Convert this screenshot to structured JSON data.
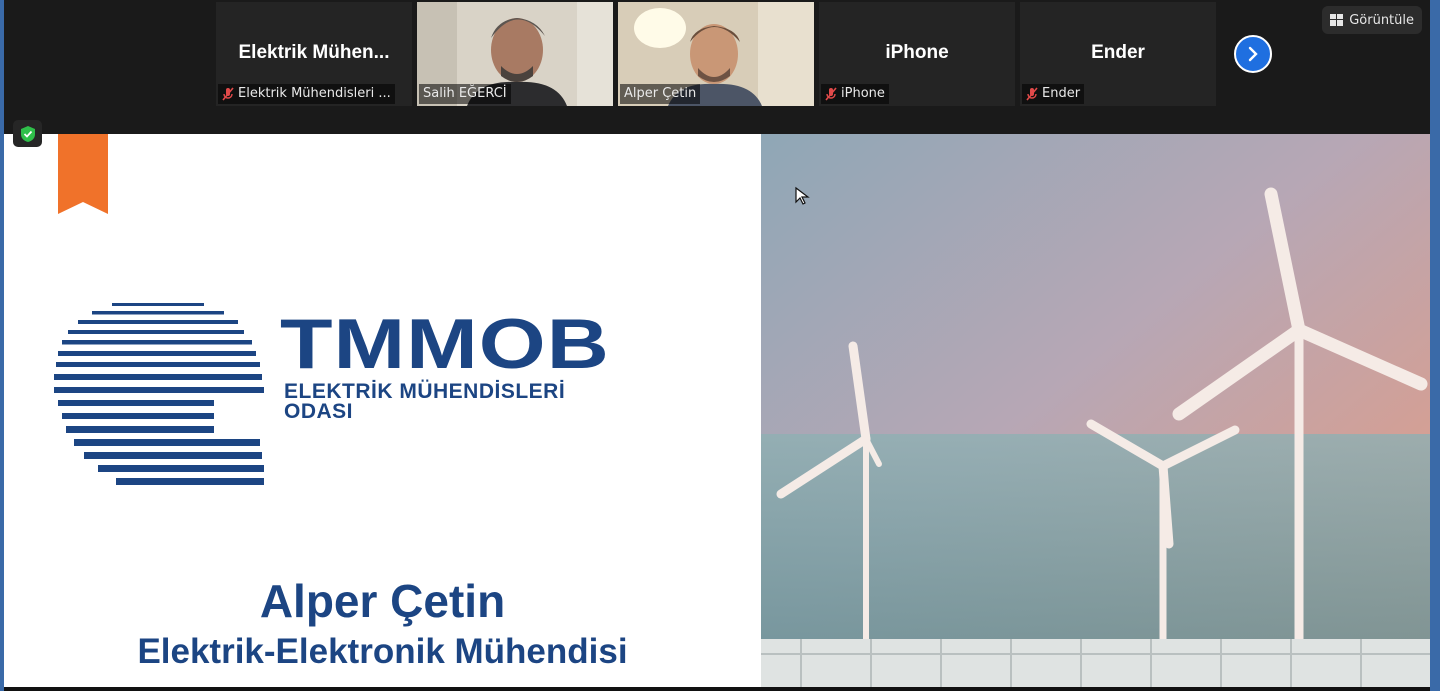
{
  "participants": [
    {
      "display": "Elektrik  Mühen...",
      "label": "Elektrik Mühendisleri ...",
      "muted": true,
      "video": false
    },
    {
      "display": "",
      "label": "Salih EĞERCİ",
      "muted": false,
      "video": true
    },
    {
      "display": "",
      "label": "Alper Çetin",
      "muted": false,
      "video": true,
      "active": true
    },
    {
      "display": "iPhone",
      "label": "iPhone",
      "muted": true,
      "video": false
    },
    {
      "display": "Ender",
      "label": "Ender",
      "muted": true,
      "video": false
    }
  ],
  "toolbar": {
    "view_label": "Görüntüle"
  },
  "slide": {
    "brand": "TMMOB",
    "brand_sub_1": "ELEKTRİK MÜHENDİSLERİ",
    "brand_sub_2": "ODASI",
    "speaker_name": "Alper Çetin",
    "speaker_title": "Elektrik-Elektronik Mühendisi"
  },
  "colors": {
    "accent": "#1f6fe0",
    "brand": "#1c4583",
    "ribbon": "#f0722a",
    "active_border": "#b7d96a",
    "shield": "#2fbf4a"
  }
}
